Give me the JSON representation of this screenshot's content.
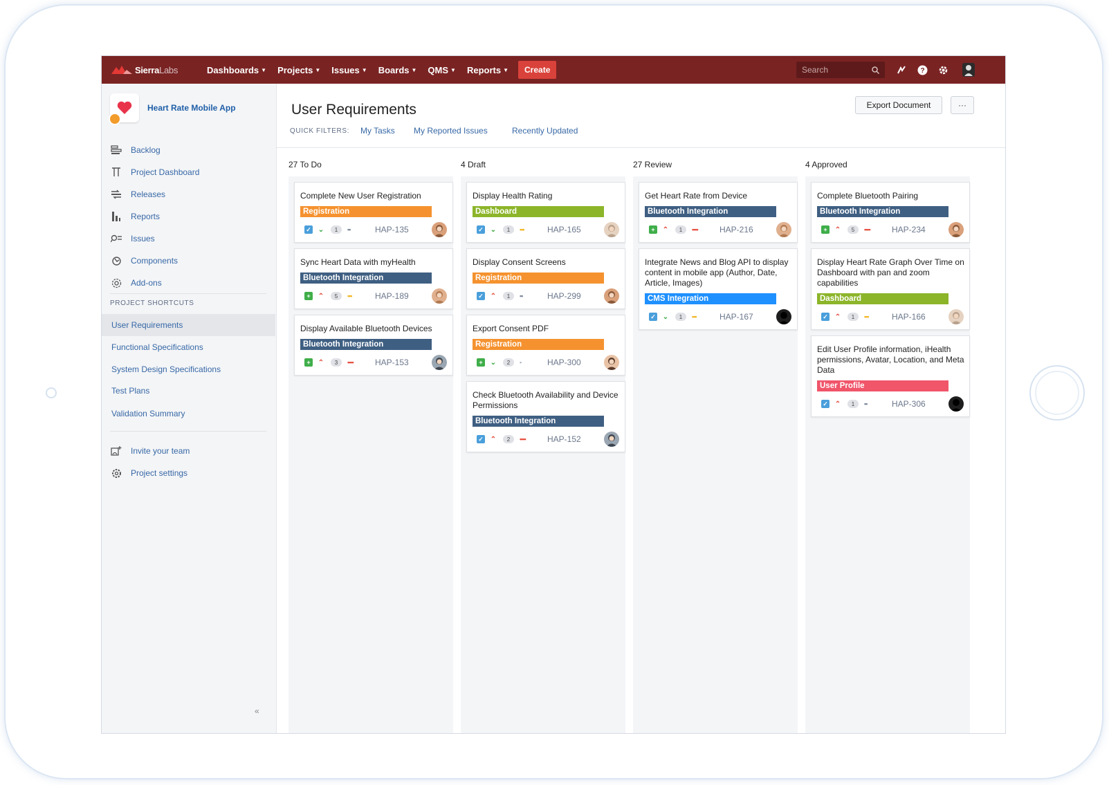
{
  "topnav": {
    "brand_bold": "Sierra",
    "brand_light": "Labs",
    "menus": [
      "Dashboards",
      "Projects",
      "Issues",
      "Boards",
      "QMS",
      "Reports"
    ],
    "create_label": "Create",
    "search_placeholder": "Search"
  },
  "sidebar": {
    "project_name": "Heart Rate Mobile App",
    "items": [
      {
        "label": "Backlog",
        "icon": "backlog-icon"
      },
      {
        "label": "Project Dashboard",
        "icon": "dashboard-icon"
      },
      {
        "label": "Releases",
        "icon": "releases-icon"
      },
      {
        "label": "Reports",
        "icon": "reports-icon"
      },
      {
        "label": "Issues",
        "icon": "issues-icon"
      },
      {
        "label": "Components",
        "icon": "components-icon"
      },
      {
        "label": "Add-ons",
        "icon": "addons-icon"
      }
    ],
    "shortcuts_heading": "PROJECT SHORTCUTS",
    "shortcuts": [
      "User Requirements",
      "Functional Specifications",
      "System Design Specifications",
      "Test Plans",
      "Validation Summary"
    ],
    "footer_items": [
      {
        "label": "Invite your team",
        "icon": "invite-icon"
      },
      {
        "label": "Project settings",
        "icon": "settings-icon"
      }
    ],
    "collapse_glyph": "«"
  },
  "main": {
    "title": "User Requirements",
    "quick_filters_label": "QUICK FILTERS:",
    "quick_filters": [
      "My Tasks",
      "My Reported Issues",
      "Recently Updated"
    ],
    "export_label": "Export Document",
    "more_label": "···"
  },
  "colors": {
    "Registration": "#f5922f",
    "Dashboard": "#8cb52a",
    "Bluetooth Integration": "#3f5f82",
    "CMS Integration": "#1e90ff",
    "User Profile": "#f0556a"
  },
  "columns": [
    {
      "header": "27 To Do",
      "cards": [
        {
          "title": "Complete New User Registration",
          "label": "Registration",
          "type": "task",
          "priority": "lowest",
          "points": "1",
          "dots": "sm",
          "key": "HAP-135",
          "avatar": "f1"
        },
        {
          "title": "Sync Heart Data with myHealth",
          "label": "Bluetooth Integration",
          "type": "story",
          "priority": "high",
          "points": "5",
          "dots": "med",
          "key": "HAP-189",
          "avatar": "f2"
        },
        {
          "title": "Display Available Bluetooth Devices",
          "label": "Bluetooth Integration",
          "type": "story",
          "priority": "high",
          "points": "3",
          "dots": "hi",
          "key": "HAP-153",
          "avatar": "m1"
        }
      ]
    },
    {
      "header": "4 Draft",
      "cards": [
        {
          "title": "Display Health Rating",
          "label": "Dashboard",
          "type": "task",
          "priority": "lowest",
          "points": "1",
          "dots": "med",
          "key": "HAP-165",
          "avatar": "m2"
        },
        {
          "title": "Display Consent Screens",
          "label": "Registration",
          "type": "task",
          "priority": "high",
          "points": "1",
          "dots": "sm",
          "key": "HAP-299",
          "avatar": "f1"
        },
        {
          "title": "Export Consent PDF",
          "label": "Registration",
          "type": "story",
          "priority": "lowest",
          "points": "2",
          "dots": "one",
          "key": "HAP-300",
          "avatar": "m3"
        },
        {
          "title": "Check Bluetooth Availability and Device Permissions",
          "label": "Bluetooth Integration",
          "type": "task",
          "priority": "high",
          "points": "2",
          "dots": "hi",
          "key": "HAP-152",
          "avatar": "m1"
        }
      ]
    },
    {
      "header": "27 Review",
      "cards": [
        {
          "title": "Get Heart Rate from Device",
          "label": "Bluetooth Integration",
          "type": "story",
          "priority": "high",
          "points": "1",
          "dots": "hi",
          "key": "HAP-216",
          "avatar": "f2"
        },
        {
          "title": "Integrate News and Blog API to display content in mobile app (Author, Date, Article, Images)",
          "label": "CMS Integration",
          "type": "task",
          "priority": "lowest",
          "points": "1",
          "dots": "med",
          "key": "HAP-167",
          "avatar": "dark"
        }
      ]
    },
    {
      "header": "4 Approved",
      "cards": [
        {
          "title": "Complete Bluetooth Pairing",
          "label": "Bluetooth Integration",
          "type": "story",
          "priority": "high",
          "points": "5",
          "dots": "hi",
          "key": "HAP-234",
          "avatar": "f1"
        },
        {
          "title": "Display Heart Rate Graph Over Time on Dashboard with pan and zoom capabilities",
          "label": "Dashboard",
          "type": "task",
          "priority": "high",
          "points": "1",
          "dots": "med",
          "key": "HAP-166",
          "avatar": "m2"
        },
        {
          "title": "Edit User Profile information, iHealth permissions, Avatar, Location, and Meta Data",
          "label": "User Profile",
          "type": "task",
          "priority": "high",
          "points": "1",
          "dots": "sm",
          "key": "HAP-306",
          "avatar": "dark"
        }
      ]
    }
  ]
}
